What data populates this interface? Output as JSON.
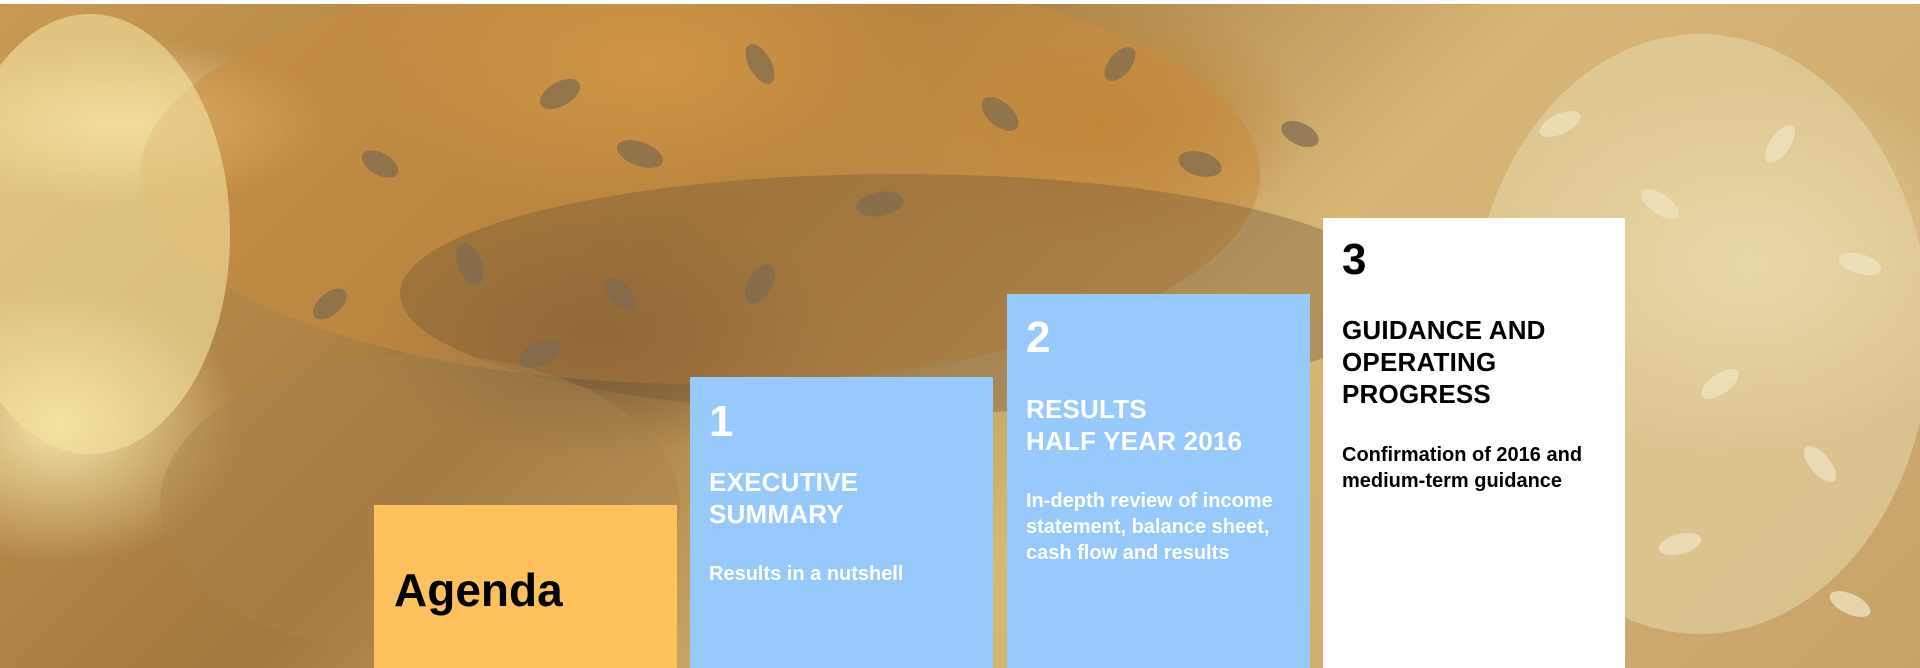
{
  "agenda": {
    "label": "Agenda"
  },
  "items": [
    {
      "number": "1",
      "title": "EXECUTIVE\nSUMMARY",
      "description": "Results in a nutshell",
      "color": "#97c9fc"
    },
    {
      "number": "2",
      "title": "RESULTS\nHALF YEAR 2016",
      "description": "In-depth review of income statement, balance sheet, cash flow and results",
      "color": "#97c9fc"
    },
    {
      "number": "3",
      "title": "GUIDANCE AND\nOPERATING\nPROGRESS",
      "description": "Confirmation of 2016 and medium-term guidance",
      "color": "#ffffff"
    }
  ],
  "colors": {
    "agenda": "#fdc15e",
    "accent_blue": "#97c9fc",
    "white": "#ffffff"
  }
}
